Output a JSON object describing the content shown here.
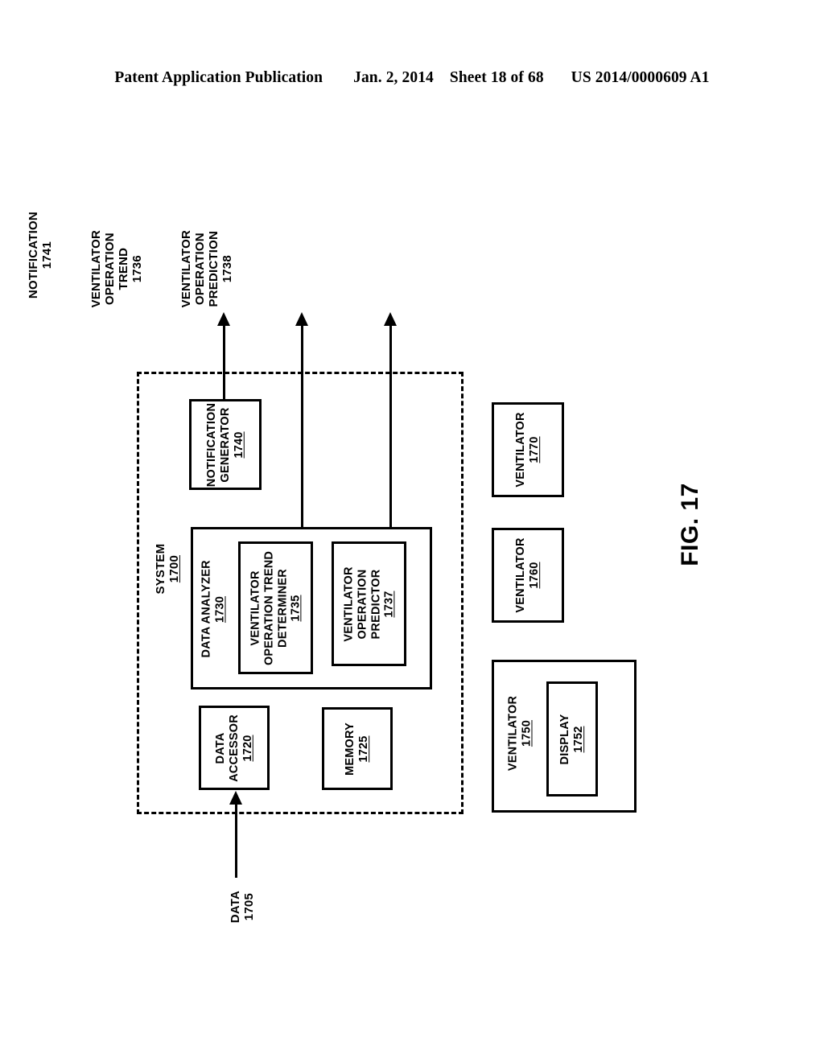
{
  "header": {
    "publication": "Patent Application Publication",
    "date": "Jan. 2, 2014",
    "sheet": "Sheet 18 of 68",
    "patent_number": "US 2014/0000609 A1"
  },
  "figure": {
    "caption": "FIG. 17",
    "system": {
      "label": "SYSTEM",
      "ref": "1700"
    },
    "outputs": [
      {
        "name": "notification-output",
        "lines": [
          "NOTIFICATION"
        ],
        "ref": "1741"
      },
      {
        "name": "ventilator-operation-trend-output",
        "lines": [
          "VENTILATOR",
          "OPERATION",
          "TREND"
        ],
        "ref": "1736"
      },
      {
        "name": "ventilator-operation-prediction-output",
        "lines": [
          "VENTILATOR",
          "OPERATION",
          "PREDICTION"
        ],
        "ref": "1738"
      }
    ],
    "input": {
      "name": "data-input",
      "lines": [
        "DATA"
      ],
      "ref": "1705"
    },
    "blocks": {
      "notification_generator": {
        "lines": [
          "NOTIFICATION",
          "GENERATOR"
        ],
        "ref": "1740"
      },
      "data_analyzer": {
        "lines": [
          "DATA ANALYZER"
        ],
        "ref": "1730"
      },
      "trend_determiner": {
        "lines": [
          "VENTILATOR",
          "OPERATION TREND",
          "DETERMINER"
        ],
        "ref": "1735"
      },
      "operation_predictor": {
        "lines": [
          "VENTILATOR",
          "OPERATION",
          "PREDICTOR"
        ],
        "ref": "1737"
      },
      "data_accessor": {
        "lines": [
          "DATA",
          "ACCESSOR"
        ],
        "ref": "1720"
      },
      "memory": {
        "lines": [
          "MEMORY"
        ],
        "ref": "1725"
      },
      "ventilator_1770": {
        "lines": [
          "VENTILATOR"
        ],
        "ref": "1770"
      },
      "ventilator_1760": {
        "lines": [
          "VENTILATOR"
        ],
        "ref": "1760"
      },
      "ventilator_1750": {
        "lines": [
          "VENTILATOR"
        ],
        "ref": "1750"
      },
      "display_1752": {
        "lines": [
          "DISPLAY"
        ],
        "ref": "1752"
      }
    }
  }
}
